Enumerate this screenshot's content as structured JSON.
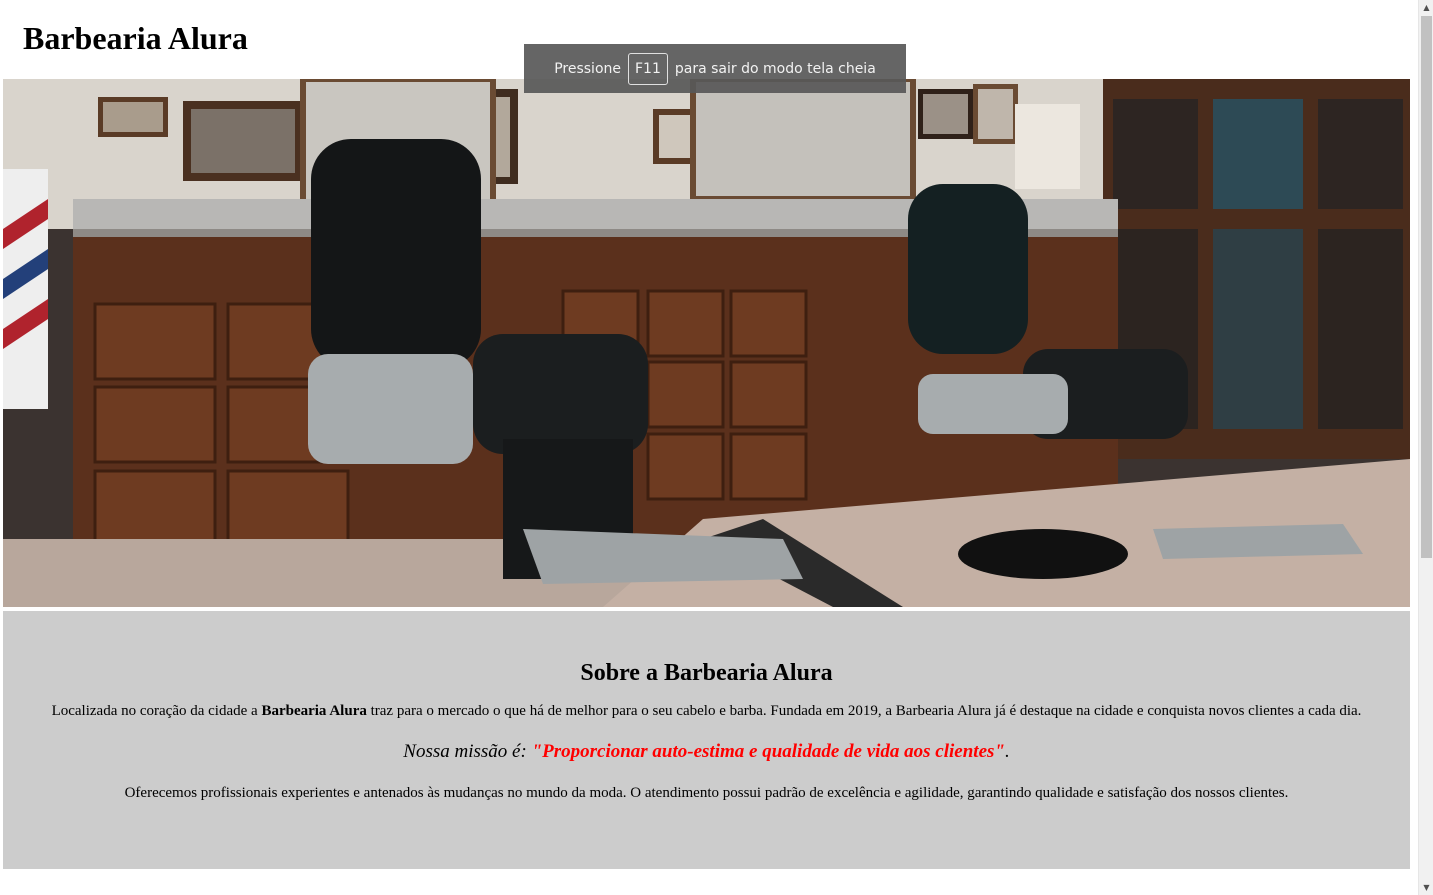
{
  "header": {
    "title": "Barbearia Alura"
  },
  "fullscreen_notice": {
    "prefix": "Pressione",
    "key": "F11",
    "suffix": "para sair do modo tela cheia"
  },
  "hero": {
    "icon": "barbershop-photo"
  },
  "about": {
    "heading": "Sobre a Barbearia Alura",
    "intro_before": "Localizada no coração da cidade a ",
    "intro_bold": "Barbearia Alura",
    "intro_after": " traz para o mercado o que há de melhor para o seu cabelo e barba. Fundada em 2019, a Barbearia Alura já é destaque na cidade e conquista novos clientes a cada dia.",
    "mission_label": "Nossa missão é: ",
    "mission_quote": "\"Proporcionar auto-estima e qualidade de vida aos clientes\"",
    "mission_end": ".",
    "services": "Oferecemos profissionais experientes e antenados às mudanças no mundo da moda. O atendimento possui padrão de excelência e agilidade, garantindo qualidade e satisfação dos nossos clientes."
  },
  "scrollbar": {
    "up_icon": "chevron-up-icon",
    "down_icon": "chevron-down-icon"
  },
  "colors": {
    "about_bg": "#cccccc",
    "mission_color": "#ff0000",
    "toast_bg": "#585858"
  }
}
